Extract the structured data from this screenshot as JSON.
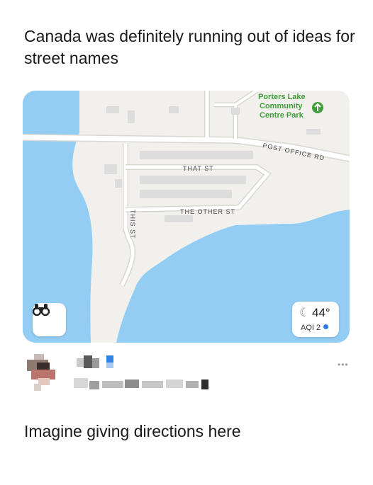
{
  "post": {
    "caption_top": "Canada was definitely running out of ideas for street names",
    "caption_bottom": "Imagine giving directions here"
  },
  "map": {
    "park_label": [
      "Porters Lake",
      "Community",
      "Centre Park"
    ],
    "streets": {
      "post_office": "POST OFFICE RD",
      "that": "THAT ST",
      "the_other": "THE OTHER ST",
      "this": "THIS ST"
    },
    "colors": {
      "water": "#93cdf3",
      "land": "#f1f0ed",
      "road": "#ffffff",
      "park": "#3f9e3a"
    }
  },
  "weather": {
    "temperature": "44°",
    "aqi_label": "AQI 2"
  },
  "icons": {
    "binoculars": "binoculars-icon",
    "moon": "moon-icon",
    "more": "more-options-icon"
  },
  "comment": {
    "more_dots": "•••"
  }
}
